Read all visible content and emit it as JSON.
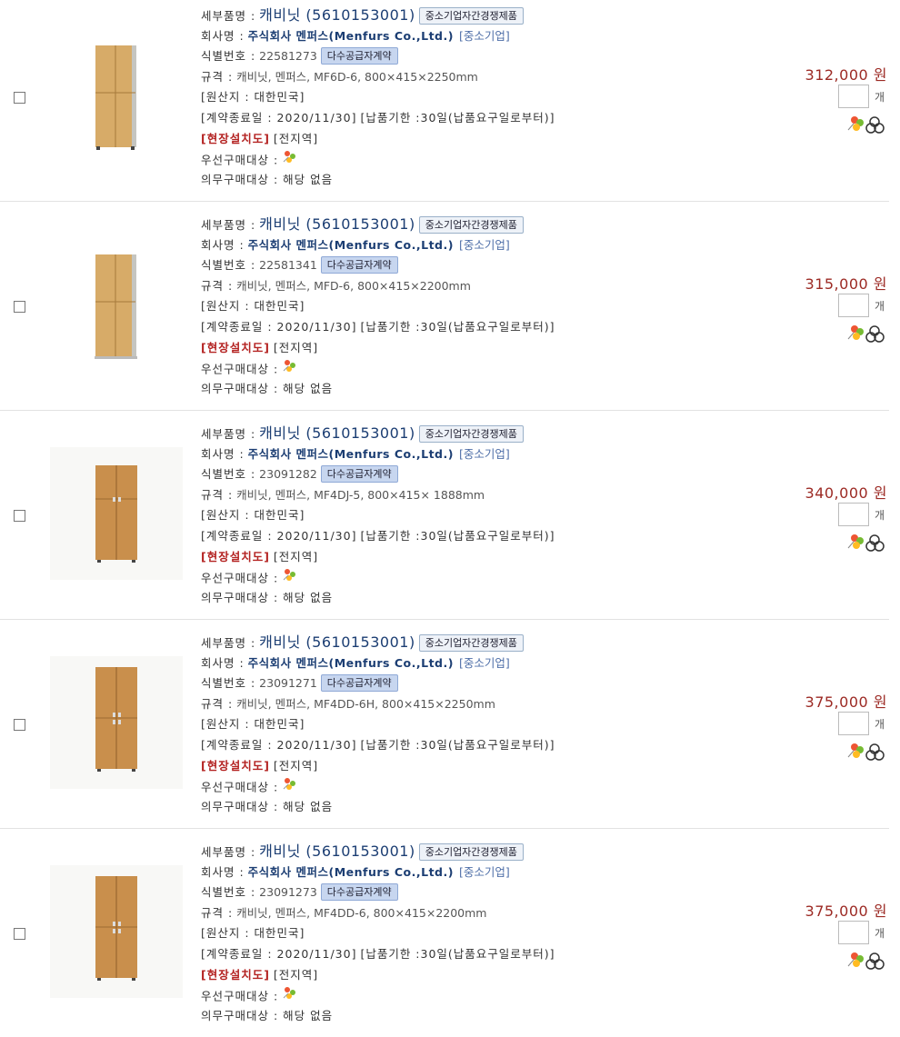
{
  "labels": {
    "detail_name": "세부품명 :",
    "company": "회사명 :",
    "id": "식별번호 :",
    "spec": "규격 :",
    "origin": "[원산지 : 대한민국]",
    "contract_end": "[계약종료일 : 2020/11/30]",
    "delivery": "[납품기한 :30일(납품요구일로부터)]",
    "onsite": "[현장설치도]",
    "region": "[전지역]",
    "priority": "우선구매대상 :",
    "mandatory": "의무구매대상 : 해당 없음",
    "unit": "개"
  },
  "products": [
    {
      "name": "캐비닛 (5610153001)",
      "badge1": "중소기업자간경쟁제품",
      "company": "주식회사 멘퍼스(Menfurs Co.,Ltd.)",
      "company_tag": "[중소기업]",
      "id": "22581273",
      "badge2": "다수공급자계약",
      "spec": "캐비닛, 멘퍼스, MF6D-6, 800×415×2250mm",
      "price": "312,000 원",
      "image": "cabinet-tall-light"
    },
    {
      "name": "캐비닛 (5610153001)",
      "badge1": "중소기업자간경쟁제품",
      "company": "주식회사 멘퍼스(Menfurs Co.,Ltd.)",
      "company_tag": "[중소기업]",
      "id": "22581341",
      "badge2": "다수공급자계약",
      "spec": "캐비닛, 멘퍼스, MFD-6, 800×415×2200mm",
      "price": "315,000 원",
      "image": "cabinet-tall-light"
    },
    {
      "name": "캐비닛 (5610153001)",
      "badge1": "중소기업자간경쟁제품",
      "company": "주식회사 멘퍼스(Menfurs Co.,Ltd.)",
      "company_tag": "[중소기업]",
      "id": "23091282",
      "badge2": "다수공급자계약",
      "spec": "캐비닛, 멘퍼스, MF4DJ-5, 800×415× 1888mm",
      "price": "340,000 원",
      "image": "cabinet-wood"
    },
    {
      "name": "캐비닛 (5610153001)",
      "badge1": "중소기업자간경쟁제품",
      "company": "주식회사 멘퍼스(Menfurs Co.,Ltd.)",
      "company_tag": "[중소기업]",
      "id": "23091271",
      "badge2": "다수공급자계약",
      "spec": "캐비닛, 멘퍼스, MF4DD-6H, 800×415×2250mm",
      "price": "375,000 원",
      "image": "cabinet-wood"
    },
    {
      "name": "캐비닛 (5610153001)",
      "badge1": "중소기업자간경쟁제품",
      "company": "주식회사 멘퍼스(Menfurs Co.,Ltd.)",
      "company_tag": "[중소기업]",
      "id": "23091273",
      "badge2": "다수공급자계약",
      "spec": "캐비닛, 멘퍼스, MF4DD-6, 800×415×2200mm",
      "price": "375,000 원",
      "image": "cabinet-wood"
    }
  ],
  "colors": {
    "price": "#9c2a24",
    "company": "#1c3e73",
    "onsite": "#b42322",
    "badge_blue": "#c7d6ef"
  }
}
